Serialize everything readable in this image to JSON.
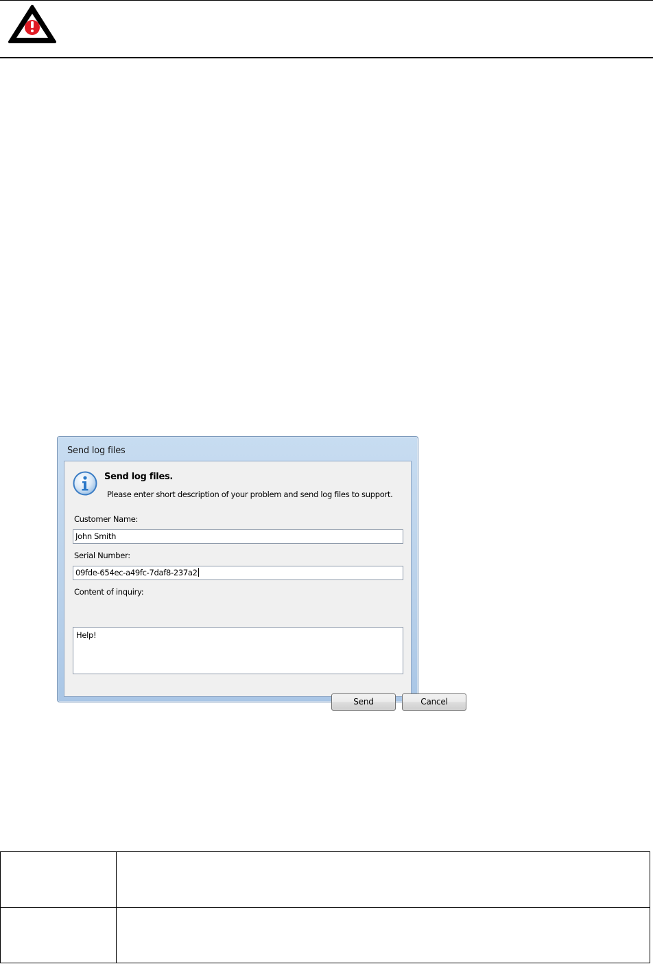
{
  "dialog": {
    "window_title": "Send log files",
    "heading": "Send log files.",
    "description": "Please enter short description of your problem and send log files to support.",
    "customer_name": {
      "label": "Customer Name:",
      "value": "John Smith"
    },
    "serial_number": {
      "label": "Serial Number:",
      "value": "09fde-654ec-a49fc-7daf8-237a2"
    },
    "inquiry": {
      "label": "Content of inquiry:",
      "value": "Help!"
    },
    "buttons": {
      "send": "Send",
      "cancel": "Cancel"
    }
  },
  "table": {
    "rows": [
      {
        "col1": "",
        "col2": ""
      },
      {
        "col1": "",
        "col2": ""
      }
    ]
  },
  "colors": {
    "warning_red": "#e01b24",
    "info_blue": "#2a78c8",
    "dialog_frame": "#b9d1ea"
  },
  "icons": {
    "header": "warning-icon",
    "dialog": "info-icon"
  }
}
